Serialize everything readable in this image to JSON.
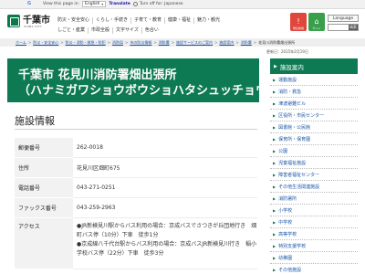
{
  "translate_bar": {
    "view_text": "View this page in:",
    "language_value": "English",
    "translate_label": "Translate",
    "option_label": "Turn off for: Japanese"
  },
  "header": {
    "logo_text": "千葉市",
    "logo_sub": "CHIBA CITY",
    "gnav": [
      "防災・安全安心",
      "くらし・手続き",
      "子育て・教育",
      "健康・福祉",
      "魅力・観光",
      "しごと・産業",
      "市政全般"
    ],
    "sub_links": [
      "文字サイズ",
      "色合い",
      "よくある質問"
    ],
    "icons": [
      {
        "label": "緊急情報",
        "symbol": "!",
        "icon": "warning-icon",
        "color": "red"
      },
      {
        "label": "サイト",
        "symbol": "⌂",
        "icon": "home-icon",
        "color": "green"
      }
    ],
    "language_button": "Language",
    "search_button": "検索"
  },
  "breadcrumb": {
    "items": [
      "ホーム",
      "防災・安全安心",
      "防災・消防・救急・防犯",
      "消防局",
      "市の防災情報",
      "消防署",
      "施設サービスのご案内",
      "施設案内",
      "消防署"
    ],
    "current": "花見川消防署畑出張所"
  },
  "updated": "更新日：2015年2月19日",
  "page": {
    "title_line1": "千葉市 花見川消防署畑出張所",
    "title_line2": "（ハナミガワショウボウショハタシュッチョウジョ）",
    "section_title": "施設情報"
  },
  "info_rows": [
    {
      "label": "郵便番号",
      "value": "262-0018"
    },
    {
      "label": "住所",
      "value": "花見川区畑町675"
    },
    {
      "label": "電話番号",
      "value": "043-271-0251"
    },
    {
      "label": "ファックス番号",
      "value": "043-259-2963"
    }
  ],
  "access": {
    "label": "アクセス",
    "items": [
      "●JR新検見川駅からバス利用の場合：京成バスでさつきが丘団地行き　畑町バス停（10分）下車　徒歩1分",
      "●京成線八千代台駅からバス利用の場合：京成バスJR新検見川行き　稲小学校バス停（22分）下車　徒歩3分"
    ]
  },
  "sidebar": {
    "heading": "施設案内",
    "items": [
      "運動施設",
      "消防・救急",
      "津波避難ビル",
      "区役所・市民センター",
      "図書館・公民館",
      "保育所・保育園",
      "公園",
      "児童福祉施設",
      "障害者福祉センター",
      "その他生活関連施設",
      "消防署所",
      "小学校",
      "中学校",
      "高等学校",
      "特別支援学校",
      "幼稚園",
      "その他施設"
    ]
  },
  "colors": {
    "brand_green": "#0e7a53",
    "link_blue": "#1a55a8",
    "alert_red": "#e0473c"
  }
}
